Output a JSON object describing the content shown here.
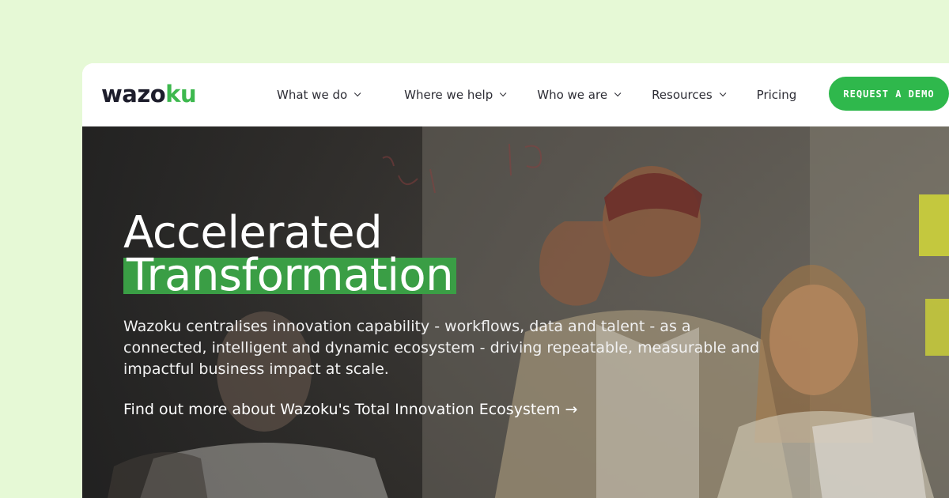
{
  "logo": {
    "text_main": "wazo",
    "text_accent": "ku"
  },
  "nav": {
    "items": [
      {
        "label": "What we do",
        "has_dropdown": true
      },
      {
        "label": "Where we help",
        "has_dropdown": true
      },
      {
        "label": "Who we are",
        "has_dropdown": true
      },
      {
        "label": "Resources",
        "has_dropdown": true
      },
      {
        "label": "Pricing",
        "has_dropdown": false
      }
    ],
    "cta_label": "REQUEST A DEMO"
  },
  "hero": {
    "headline_line1": "Accelerated",
    "headline_line2": "Transformation",
    "description": "Wazoku centralises innovation capability - workflows, data and talent - as a connected, intelligent and dynamic ecosystem - driving repeatable, measurable and impactful business impact at scale.",
    "link_text": "Find out more about Wazoku's Total Innovation Ecosystem →"
  },
  "colors": {
    "page_background": "#e6f9d6",
    "brand_green": "#2fb84c",
    "highlight_green": "#3a9e45",
    "nav_text": "#2d2d35"
  }
}
